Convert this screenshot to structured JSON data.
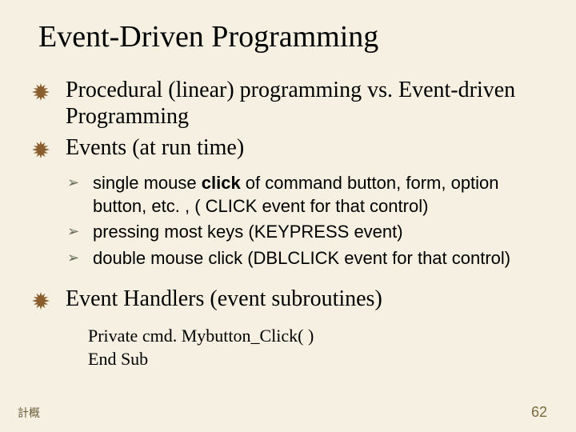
{
  "title": "Event-Driven Programming",
  "bullets": {
    "b1": "Procedural (linear) programming vs. Event-driven Programming",
    "b2": "Events  (at run time)",
    "sub1_pre": "single mouse ",
    "sub1_bold": "click",
    "sub1_post": " of command button, form, option button, etc. ,   ( CLICK event for that control)",
    "sub2": "pressing most keys (KEYPRESS event)",
    "sub3": "double mouse click (DBLCLICK event for that control)",
    "b3": "Event Handlers (event subroutines)"
  },
  "code": {
    "line1": "Private cmd. Mybutton_Click( )",
    "line2": "End Sub"
  },
  "footer": {
    "left": "計概",
    "right": "62"
  }
}
